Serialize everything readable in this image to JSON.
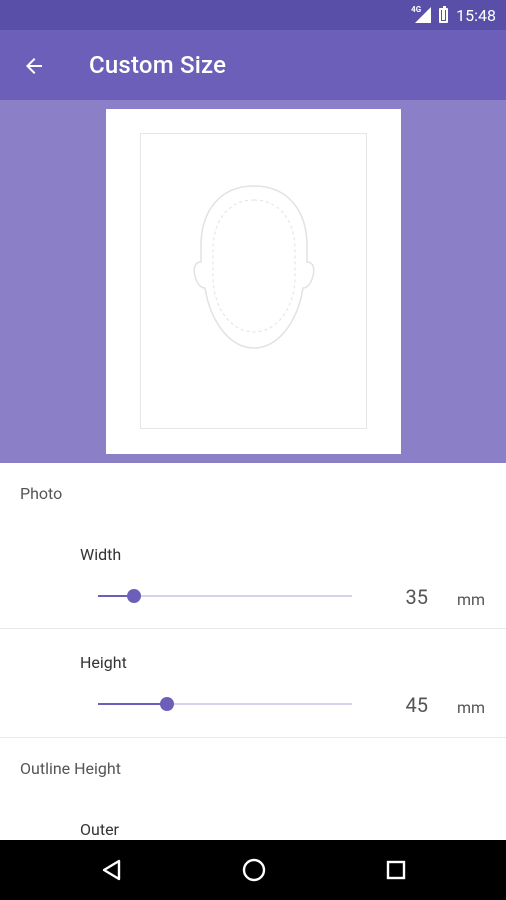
{
  "status_bar": {
    "network_label": "4G",
    "time": "15:48"
  },
  "app_bar": {
    "title": "Custom Size"
  },
  "photo_section": {
    "header": "Photo",
    "width": {
      "label": "Width",
      "value": "35",
      "unit": "mm",
      "slider_fraction": 0.14
    },
    "height": {
      "label": "Height",
      "value": "45",
      "unit": "mm",
      "slider_fraction": 0.27
    }
  },
  "outline_section": {
    "header": "Outline Height",
    "outer": {
      "label": "Outer"
    }
  },
  "colors": {
    "status_bar": "#5a4fa8",
    "app_bar": "#6c5fba",
    "preview_bg": "#8b80c8",
    "accent": "#6c5fba"
  },
  "icons": {
    "back": "arrow-back-icon",
    "nav_back": "nav-back-icon",
    "nav_home": "nav-home-icon",
    "nav_recents": "nav-recents-icon"
  }
}
